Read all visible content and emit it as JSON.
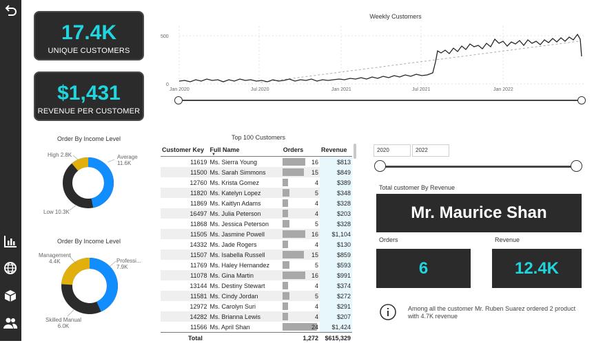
{
  "kpis": {
    "unique_customers": {
      "value": "17.4K",
      "label": "UNIQUE CUSTOMERS"
    },
    "revenue_per_customer": {
      "value": "$1,431",
      "label": "REVENUE PER CUSTOMER"
    }
  },
  "weekly_chart": {
    "title": "Weekly Customers",
    "y_ticks": [
      "500",
      "0"
    ],
    "x_ticks": [
      "Jan 2020",
      "Jul 2020",
      "Jan 2021",
      "Jul 2021",
      "Jan 2022"
    ]
  },
  "donut1": {
    "title": "Order By Income Level",
    "labels": [
      {
        "name": "High",
        "value": "2.8K"
      },
      {
        "name": "Average",
        "value": "11.6K"
      },
      {
        "name": "Low",
        "value": "10.3K"
      }
    ]
  },
  "donut2": {
    "title": "Order By Income Level",
    "labels": [
      {
        "name": "Management",
        "value": "4.4K"
      },
      {
        "name": "Professi...",
        "value": "7.9K"
      },
      {
        "name": "Skilled Manual",
        "value": "6.0K"
      }
    ]
  },
  "table": {
    "title": "Top 100 Customers",
    "headers": [
      "Customer Key",
      "Full Name",
      "Orders",
      "Revenue"
    ],
    "rows": [
      {
        "key": "11619",
        "name": "Ms. Sierra Young",
        "orders": "16",
        "revenue": "$813"
      },
      {
        "key": "11500",
        "name": "Ms. Sarah Simmons",
        "orders": "15",
        "revenue": "$849"
      },
      {
        "key": "12760",
        "name": "Ms. Krista Gomez",
        "orders": "4",
        "revenue": "$389"
      },
      {
        "key": "11820",
        "name": "Ms. Katelyn Lopez",
        "orders": "5",
        "revenue": "$348"
      },
      {
        "key": "11869",
        "name": "Ms. Kaitlyn Adams",
        "orders": "4",
        "revenue": "$328"
      },
      {
        "key": "16497",
        "name": "Ms. Julia Peterson",
        "orders": "4",
        "revenue": "$203"
      },
      {
        "key": "11868",
        "name": "Ms. Jessica Peterson",
        "orders": "5",
        "revenue": "$328"
      },
      {
        "key": "11505",
        "name": "Ms. Jasmine Powell",
        "orders": "16",
        "revenue": "$1,104"
      },
      {
        "key": "14332",
        "name": "Ms. Jade Rogers",
        "orders": "4",
        "revenue": "$130"
      },
      {
        "key": "11507",
        "name": "Ms. Isabella Russell",
        "orders": "15",
        "revenue": "$859"
      },
      {
        "key": "11769",
        "name": "Ms. Haley Hernandez",
        "orders": "5",
        "revenue": "$593"
      },
      {
        "key": "11078",
        "name": "Ms. Gina Martin",
        "orders": "16",
        "revenue": "$991"
      },
      {
        "key": "13144",
        "name": "Ms. Destiny Stewart",
        "orders": "4",
        "revenue": "$374"
      },
      {
        "key": "11581",
        "name": "Ms. Cindy Jordan",
        "orders": "5",
        "revenue": "$272"
      },
      {
        "key": "12972",
        "name": "Ms. Carolyn Suri",
        "orders": "4",
        "revenue": "$291"
      },
      {
        "key": "14282",
        "name": "Ms. Brianna Lewis",
        "orders": "4",
        "revenue": "$207"
      },
      {
        "key": "11566",
        "name": "Ms. April Shan",
        "orders": "24",
        "revenue": "$1,424"
      }
    ],
    "total": {
      "label": "Total",
      "orders": "1,272",
      "revenue": "$615,329"
    }
  },
  "date_filter": {
    "start": "2020",
    "end": "2022"
  },
  "top_customer": {
    "title": "Total customer By Revenue",
    "name": "Mr. Maurice Shan",
    "orders_label": "Orders",
    "orders_value": "6",
    "revenue_label": "Revenue",
    "revenue_value": "12.4K"
  },
  "info_text": "Among all the customer Mr. Ruben Suarez ordered 2 product with 4.7K revenue",
  "colors": {
    "accent": "#20d5de",
    "dark": "#2b2b2b",
    "blue": "#118dff",
    "yellow": "#e1b00d"
  },
  "icons": [
    "back-arrow-icon",
    "bar-chart-icon",
    "globe-icon",
    "box-icon",
    "people-icon",
    "info-icon"
  ]
}
